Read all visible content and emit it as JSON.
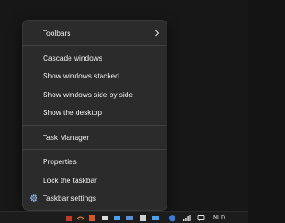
{
  "menu": {
    "items": [
      {
        "label": "Toolbars",
        "submenu": true
      },
      {
        "label": "Cascade windows"
      },
      {
        "label": "Show windows stacked"
      },
      {
        "label": "Show windows side by side"
      },
      {
        "label": "Show the desktop"
      },
      {
        "label": "Task Manager"
      },
      {
        "label": "Properties"
      },
      {
        "label": "Lock the taskbar"
      },
      {
        "label": "Taskbar settings",
        "icon": "gear-icon"
      }
    ]
  },
  "taskbar": {
    "language": "NLD",
    "tray_icons": [
      "tray-app-icon",
      "wifi-icon",
      "tray-app-icon",
      "tray-app-icon",
      "tray-app-icon",
      "tray-app-icon",
      "tray-app-icon",
      "tray-app-icon",
      "security-icon",
      "signal-bars-icon",
      "chat-icon"
    ]
  },
  "colors": {
    "menu_bg": "#2b2b2b",
    "menu_text": "#f2f2f2",
    "separator": "#3f3f3f",
    "accent_blue": "#4aa3f0"
  }
}
